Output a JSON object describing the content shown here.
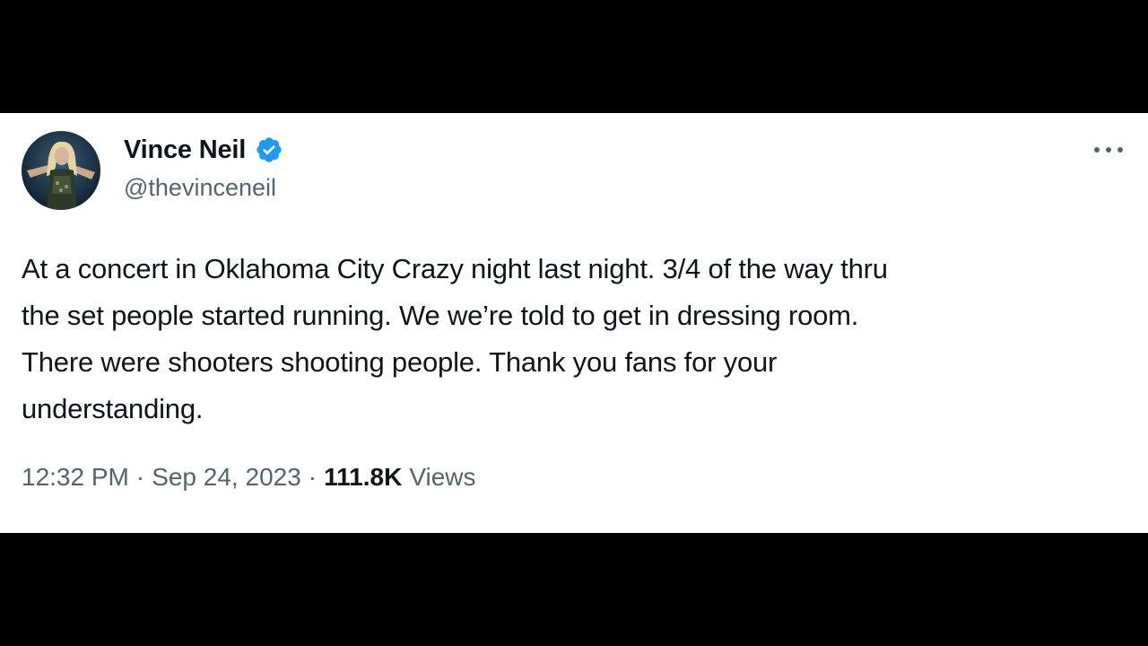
{
  "author": {
    "display_name": "Vince Neil",
    "handle": "@thevinceneil",
    "verified": true,
    "avatar_icon": "profile-photo",
    "verified_icon": "verified-badge-icon"
  },
  "tweet": {
    "text": "At a concert in Oklahoma City Crazy night last night. 3/4 of the way thru\nthe set people started running. We we’re told to get in dressing room.\nThere were shooters shooting people. Thank you fans for your\nunderstanding.",
    "time": "12:32 PM",
    "separator": "·",
    "date": "Sep 24, 2023",
    "views_count": "111.8K",
    "views_label": "Views"
  },
  "menu": {
    "more_icon": "more-horizontal-icon"
  },
  "colors": {
    "background": "#000000",
    "card": "#ffffff",
    "primary_text": "#0f1419",
    "secondary_text": "#536471",
    "verified_blue": "#1d9bf0"
  }
}
